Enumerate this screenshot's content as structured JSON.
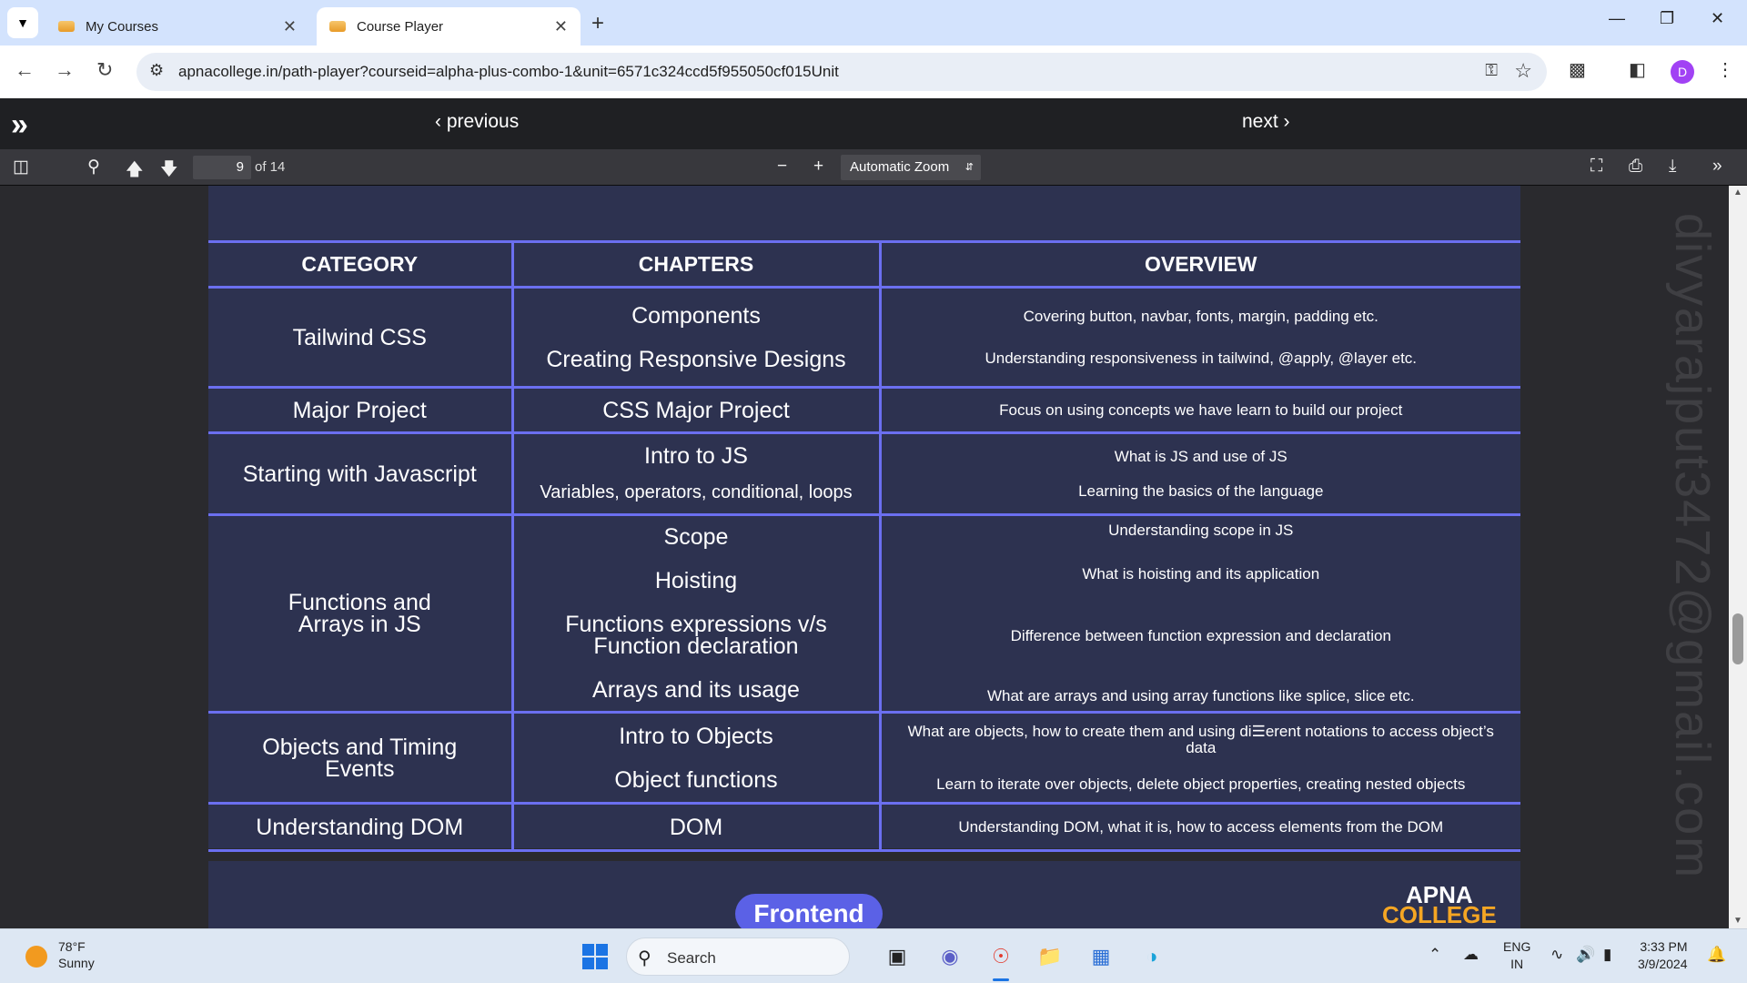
{
  "browser": {
    "tabs": [
      {
        "label": "My Courses",
        "active": false
      },
      {
        "label": "Course Player",
        "active": true
      }
    ],
    "url": "apnacollege.in/path-player?courseid=alpha-plus-combo-1&unit=6571c324ccd5f955050cf015Unit",
    "profile_initial": "D"
  },
  "player": {
    "previous_label": "previous",
    "next_label": "next"
  },
  "pdf_toolbar": {
    "page_number": "9",
    "page_count_text": "of 14",
    "zoom": "Automatic Zoom"
  },
  "document": {
    "watermark": "divyarajput3472@gmail.com",
    "headers": {
      "category": "CATEGORY",
      "chapters": "CHAPTERS",
      "overview": "OVERVIEW"
    },
    "rows": [
      {
        "category": "Tailwind CSS",
        "chapters": [
          "Components",
          "Creating Responsive Designs"
        ],
        "overview": [
          "Covering button, navbar, fonts, margin, padding etc.",
          "Understanding responsiveness in tailwind, @apply, @layer etc."
        ]
      },
      {
        "category": "Major Project",
        "chapters": [
          "CSS Major Project"
        ],
        "overview": [
          "Focus on using concepts we have learn to build our project"
        ]
      },
      {
        "category": "Starting with Javascript",
        "chapters": [
          "Intro to JS",
          "Variables, operators, conditional, loops"
        ],
        "overview": [
          "What is JS and use of JS",
          "Learning the basics of the language"
        ]
      },
      {
        "category": "Functions and Arrays in JS",
        "chapters": [
          "Scope",
          "Hoisting",
          "Functions expressions v/s Function declaration",
          "Arrays and its usage"
        ],
        "overview": [
          "Understanding scope in JS",
          "What is hoisting and its application",
          "Difference between function expression and declaration",
          "What are arrays and using array functions like splice, slice etc."
        ]
      },
      {
        "category": "Objects and Timing Events",
        "chapters": [
          "Intro to Objects",
          "Object functions"
        ],
        "overview": [
          "What are objects, how to create them and using di☰erent notations to access object’s data",
          "Learn to iterate over objects, delete object properties, creating nested objects"
        ]
      },
      {
        "category": "Understanding DOM",
        "chapters": [
          "DOM"
        ],
        "overview": [
          "Understanding DOM, what it is, how to access elements from the DOM"
        ]
      }
    ],
    "next_page": {
      "pill": "Frontend",
      "logo_line1": "APNA",
      "logo_line2": "COLLEGE"
    }
  },
  "taskbar": {
    "temperature": "78°F",
    "weather": "Sunny",
    "search_placeholder": "Search",
    "language": "ENG",
    "region": "IN",
    "time": "3:33 PM",
    "date": "3/9/2024"
  },
  "colors": {
    "page_bg": "#2d3250",
    "table_border": "#6b6ff0",
    "pill": "#5b61e6"
  }
}
